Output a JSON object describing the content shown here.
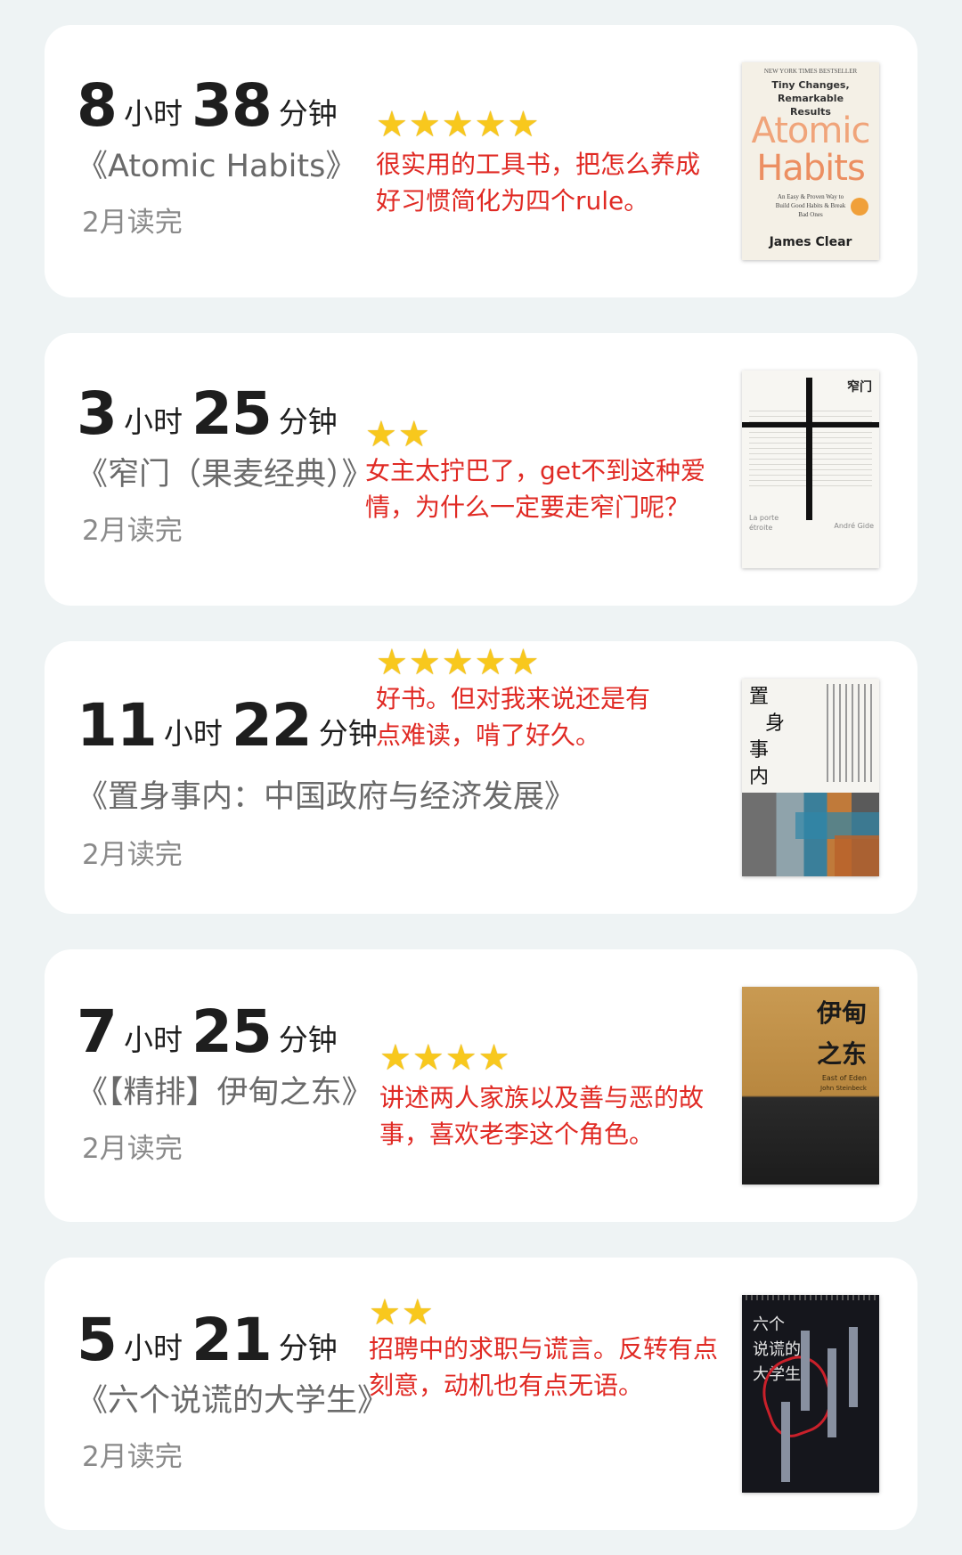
{
  "books": [
    {
      "hours": "8",
      "hours_unit": "小时",
      "minutes": "38",
      "minutes_unit": "分钟",
      "title": "《Atomic Habits》",
      "finished": "2月读完",
      "rating": 5,
      "stars_text": "★★★★★",
      "review": "很实用的工具书，把怎么养成好习惯简化为四个rule。",
      "cover": {
        "top_line": "NEW YORK TIMES BESTSELLER",
        "tagline": "Tiny Changes, Remarkable Results",
        "title_1": "Atomic",
        "title_2": "Habits",
        "sub": "An Easy & Proven Way to Build Good Habits & Break Bad Ones",
        "author": "James Clear"
      }
    },
    {
      "hours": "3",
      "hours_unit": "小时",
      "minutes": "25",
      "minutes_unit": "分钟",
      "title": "《窄门（果麦经典）》",
      "finished": "2月读完",
      "rating": 2,
      "stars_text": "★★",
      "review": "女主太拧巴了，get不到这种爱情，为什么一定要走窄门呢？",
      "cover": {
        "title": "窄门",
        "left_bottom": "La porte étroite",
        "right_bottom": "André Gide"
      }
    },
    {
      "hours": "11",
      "hours_unit": "小时",
      "minutes": "22",
      "minutes_unit": "分钟",
      "title": "《置身事内：中国政府与经济发展》",
      "finished": "2月读完",
      "rating": 5,
      "stars_text": "★★★★★",
      "review": "好书。但对我来说还是有点难读，啃了好久。",
      "cover": {
        "title_chars": [
          "置",
          "身",
          "事",
          "内"
        ]
      }
    },
    {
      "hours": "7",
      "hours_unit": "小时",
      "minutes": "25",
      "minutes_unit": "分钟",
      "title": "《【精排】伊甸之东》",
      "finished": "2月读完",
      "rating": 4,
      "stars_text": "★★★★",
      "review": "讲述两人家族以及善与恶的故事，喜欢老李这个角色。",
      "cover": {
        "title_1": "伊甸",
        "title_2": "之东",
        "en_title": "East of Eden",
        "author": "John Steinbeck"
      }
    },
    {
      "hours": "5",
      "hours_unit": "小时",
      "minutes": "21",
      "minutes_unit": "分钟",
      "title": "《六个说谎的大学生》",
      "finished": "2月读完",
      "rating": 2,
      "stars_text": "★★",
      "review": "招聘中的求职与谎言。反转有点刻意，动机也有点无语。",
      "cover": {
        "title_1": "六个",
        "title_2": "说谎的",
        "title_3": "大学生"
      }
    }
  ],
  "colors": {
    "background": "#eef3f4",
    "card": "#ffffff",
    "review_text": "#e02a24",
    "star": "#f8c81d"
  },
  "icons": {
    "rating": "star-icon"
  }
}
